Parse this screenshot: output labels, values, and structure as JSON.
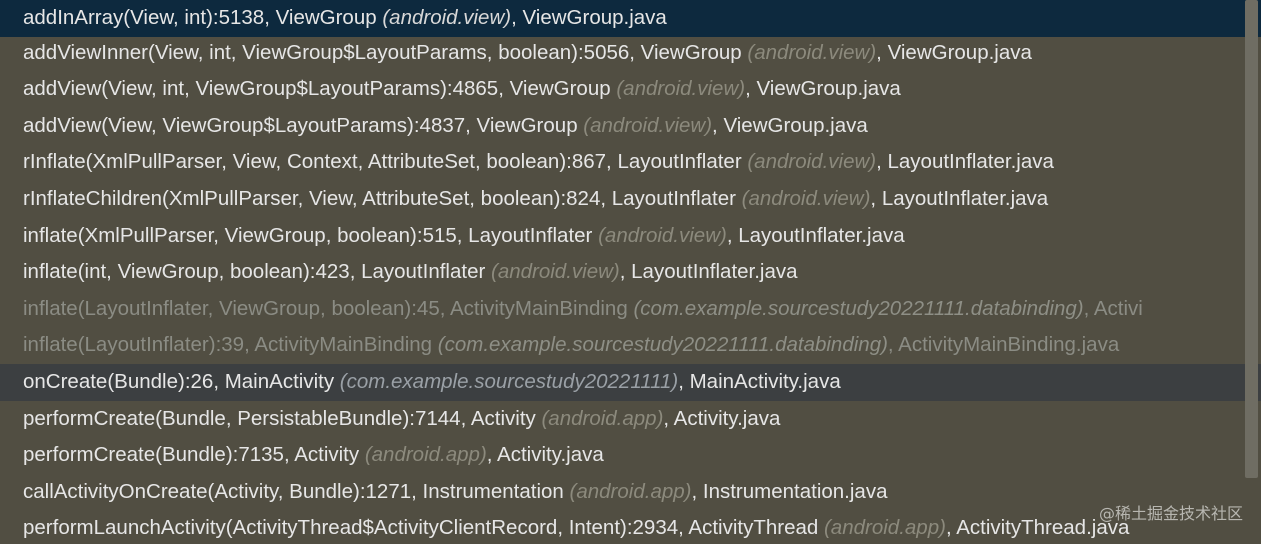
{
  "frames": [
    {
      "method": "addInArray(View, int):5138, ViewGroup ",
      "package": "(android.view)",
      "file": ", ViewGroup.java"
    },
    {
      "method": "addViewInner(View, int, ViewGroup$LayoutParams, boolean):5056, ViewGroup ",
      "package": "(android.view)",
      "file": ", ViewGroup.java"
    },
    {
      "method": "addView(View, int, ViewGroup$LayoutParams):4865, ViewGroup ",
      "package": "(android.view)",
      "file": ", ViewGroup.java"
    },
    {
      "method": "addView(View, ViewGroup$LayoutParams):4837, ViewGroup ",
      "package": "(android.view)",
      "file": ", ViewGroup.java"
    },
    {
      "method": "rInflate(XmlPullParser, View, Context, AttributeSet, boolean):867, LayoutInflater ",
      "package": "(android.view)",
      "file": ", LayoutInflater.java"
    },
    {
      "method": "rInflateChildren(XmlPullParser, View, AttributeSet, boolean):824, LayoutInflater ",
      "package": "(android.view)",
      "file": ", LayoutInflater.java"
    },
    {
      "method": "inflate(XmlPullParser, ViewGroup, boolean):515, LayoutInflater ",
      "package": "(android.view)",
      "file": ", LayoutInflater.java"
    },
    {
      "method": "inflate(int, ViewGroup, boolean):423, LayoutInflater ",
      "package": "(android.view)",
      "file": ", LayoutInflater.java"
    },
    {
      "method": "inflate(LayoutInflater, ViewGroup, boolean):45, ActivityMainBinding ",
      "package": "(com.example.sourcestudy20221111.databinding)",
      "file": ", Activi"
    },
    {
      "method": "inflate(LayoutInflater):39, ActivityMainBinding ",
      "package": "(com.example.sourcestudy20221111.databinding)",
      "file": ", ActivityMainBinding.java"
    },
    {
      "method": "onCreate(Bundle):26, MainActivity ",
      "package": "(com.example.sourcestudy20221111)",
      "file": ", MainActivity.java"
    },
    {
      "method": "performCreate(Bundle, PersistableBundle):7144, Activity ",
      "package": "(android.app)",
      "file": ", Activity.java"
    },
    {
      "method": "performCreate(Bundle):7135, Activity ",
      "package": "(android.app)",
      "file": ", Activity.java"
    },
    {
      "method": "callActivityOnCreate(Activity, Bundle):1271, Instrumentation ",
      "package": "(android.app)",
      "file": ", Instrumentation.java"
    },
    {
      "method": "performLaunchActivity(ActivityThread$ActivityClientRecord, Intent):2934, ActivityThread ",
      "package": "(android.app)",
      "file": ", ActivityThread.java"
    }
  ],
  "watermark": "@稀土掘金技术社区",
  "colors": {
    "background": "#514e42",
    "selected_row": "#0d293e",
    "current_row": "#3c3f41",
    "text": "#e6e6e6",
    "library_text": "#8b8c84"
  }
}
